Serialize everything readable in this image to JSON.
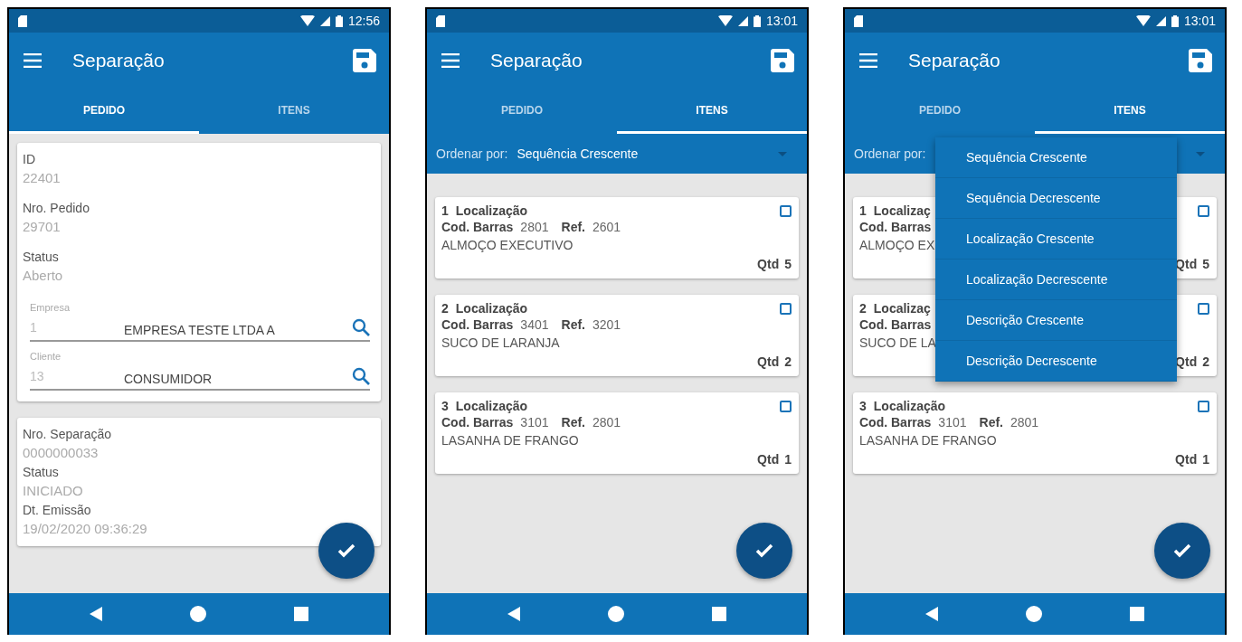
{
  "screens": [
    {
      "kind": "pedido",
      "status_bar": {
        "time": "12:56"
      },
      "app_bar": {
        "title": "Separação"
      },
      "tabs": [
        {
          "label": "PEDIDO",
          "selected": true
        },
        {
          "label": "ITENS",
          "selected": false
        }
      ],
      "order_card": {
        "fields": [
          {
            "label": "ID",
            "value": "22401"
          },
          {
            "label": "Nro. Pedido",
            "value": "29701"
          },
          {
            "label": "Status",
            "value": "Aberto"
          }
        ],
        "lookups": [
          {
            "label": "Empresa",
            "code": "1",
            "name": "EMPRESA TESTE LTDA A"
          },
          {
            "label": "Cliente",
            "code": "13",
            "name": "CONSUMIDOR"
          }
        ]
      },
      "separation_card": {
        "fields": [
          {
            "label": "Nro. Separação",
            "value": "0000000033"
          },
          {
            "label": "Status",
            "value": "INICIADO"
          },
          {
            "label": "Dt. Emissão",
            "value": "19/02/2020 09:36:29"
          }
        ]
      }
    },
    {
      "kind": "itens",
      "status_bar": {
        "time": "13:01"
      },
      "app_bar": {
        "title": "Separação"
      },
      "tabs": [
        {
          "label": "PEDIDO",
          "selected": false
        },
        {
          "label": "ITENS",
          "selected": true
        }
      ],
      "sort": {
        "label": "Ordenar por:",
        "value": "Sequência Crescente"
      },
      "items": [
        {
          "seq": "1",
          "location": "Localização",
          "barcode_label": "Cod. Barras",
          "barcode": "2801",
          "ref_label": "Ref.",
          "ref": "2601",
          "description": "ALMOÇO EXECUTIVO",
          "qty_label": "Qtd",
          "qty": "5",
          "checked": false
        },
        {
          "seq": "2",
          "location": "Localização",
          "barcode_label": "Cod. Barras",
          "barcode": "3401",
          "ref_label": "Ref.",
          "ref": "3201",
          "description": "SUCO DE LARANJA",
          "qty_label": "Qtd",
          "qty": "2",
          "checked": false
        },
        {
          "seq": "3",
          "location": "Localização",
          "barcode_label": "Cod. Barras",
          "barcode": "3101",
          "ref_label": "Ref.",
          "ref": "2801",
          "description": "LASANHA DE FRANGO",
          "qty_label": "Qtd",
          "qty": "1",
          "checked": false
        }
      ]
    },
    {
      "kind": "itens",
      "status_bar": {
        "time": "13:01"
      },
      "app_bar": {
        "title": "Separação"
      },
      "tabs": [
        {
          "label": "PEDIDO",
          "selected": false
        },
        {
          "label": "ITENS",
          "selected": true
        }
      ],
      "sort": {
        "label": "Ordenar por:"
      },
      "sort_menu": {
        "options": [
          "Sequência Crescente",
          "Sequência Decrescente",
          "Localização Crescente",
          "Localização Decrescente",
          "Descrição Crescente",
          "Descrição Decrescente"
        ]
      },
      "items": [
        {
          "seq": "1",
          "location": "Localizaç",
          "barcode_label": "Cod. Barras",
          "description": "ALMOÇO EX",
          "qty_label": "Qtd",
          "qty": "5",
          "checked": false
        },
        {
          "seq": "2",
          "location": "Localizaç",
          "barcode_label": "Cod. Barras",
          "description": "SUCO DE LA",
          "qty_label": "Qtd",
          "qty": "2",
          "checked": false
        },
        {
          "seq": "3",
          "location": "Localização",
          "barcode_label": "Cod. Barras",
          "barcode": "3101",
          "ref_label": "Ref.",
          "ref": "2801",
          "description": "LASANHA DE FRANGO",
          "qty_label": "Qtd",
          "qty": "1",
          "checked": false
        }
      ]
    }
  ]
}
